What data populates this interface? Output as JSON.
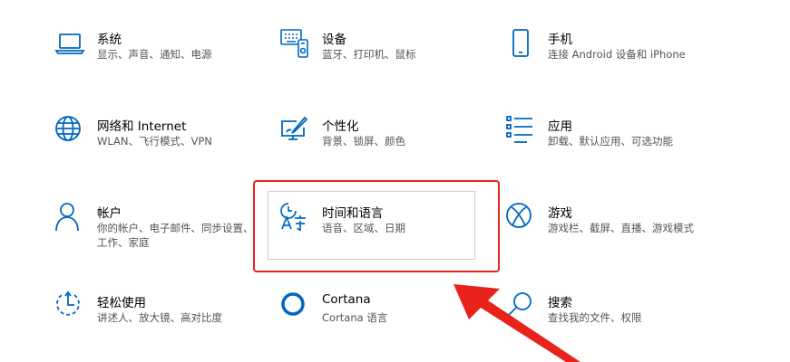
{
  "accent_color": "#0067c0",
  "annotation_color": "#e8231c",
  "tiles": [
    {
      "title": "系统",
      "desc": "显示、声音、通知、电源",
      "icon": "laptop-icon"
    },
    {
      "title": "设备",
      "desc": "蓝牙、打印机、鼠标",
      "icon": "devices-icon"
    },
    {
      "title": "手机",
      "desc": "连接 Android 设备和 iPhone",
      "icon": "phone-icon"
    },
    {
      "title": "网络和 Internet",
      "desc": "WLAN、飞行模式、VPN",
      "icon": "globe-icon"
    },
    {
      "title": "个性化",
      "desc": "背景、锁屏、颜色",
      "icon": "paint-icon"
    },
    {
      "title": "应用",
      "desc": "卸载、默认应用、可选功能",
      "icon": "apps-list-icon"
    },
    {
      "title": "帐户",
      "desc": "你的帐户、电子邮件、同步设置、工作、家庭",
      "icon": "person-icon"
    },
    {
      "title": "时间和语言",
      "desc": "语音、区域、日期",
      "icon": "time-language-icon"
    },
    {
      "title": "游戏",
      "desc": "游戏栏、截屏、直播、游戏模式",
      "icon": "xbox-icon"
    },
    {
      "title": "轻松使用",
      "desc": "讲述人、放大镜、高对比度",
      "icon": "ease-of-access-icon"
    },
    {
      "title": "Cortana",
      "desc": "Cortana 语言",
      "icon": "cortana-icon"
    },
    {
      "title": "搜索",
      "desc": "查找我的文件、权限",
      "icon": "search-icon"
    }
  ]
}
